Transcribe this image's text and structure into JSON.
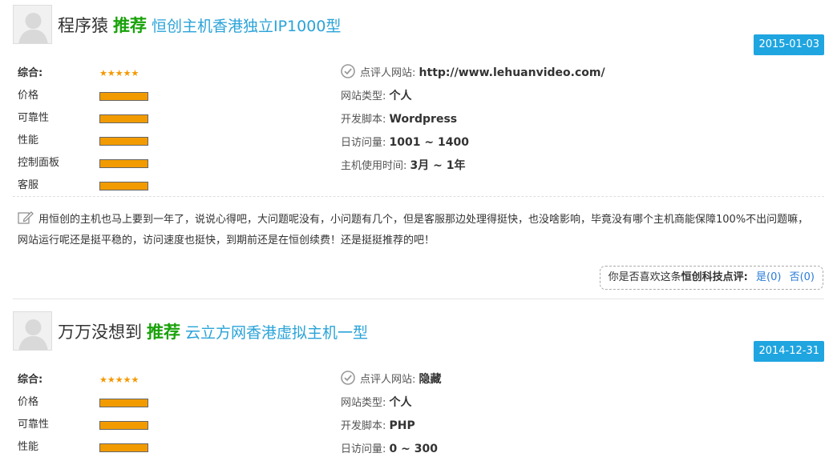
{
  "reviews": [
    {
      "username": "程序猿",
      "recommend": "推荐",
      "product": "恒创主机香港独立IP1000型",
      "date": "2015-01-03",
      "ratings": [
        {
          "label": "综合:",
          "type": "stars",
          "stars": "★★★★★",
          "value": 5
        },
        {
          "label": "价格",
          "type": "bar",
          "value": 1.0
        },
        {
          "label": "可靠性",
          "type": "bar",
          "value": 1.0
        },
        {
          "label": "性能",
          "type": "bar",
          "value": 1.0
        },
        {
          "label": "控制面板",
          "type": "bar",
          "value": 1.0
        },
        {
          "label": "客服",
          "type": "bar",
          "value": 1.0
        }
      ],
      "meta": [
        {
          "label": "点评人网站:",
          "value": "http://www.lehuanvideo.com/",
          "icon": "check-circle-icon"
        },
        {
          "label": "网站类型:",
          "value": "个人"
        },
        {
          "label": "开发脚本:",
          "value": "Wordpress"
        },
        {
          "label": "日访问量:",
          "value": "1001 ~ 1400"
        },
        {
          "label": "主机使用时间:",
          "value": "3月 ~ 1年"
        }
      ],
      "comment": "用恒创的主机也马上要到一年了，说说心得吧，大问题呢没有，小问题有几个，但是客服那边处理得挺快，也没啥影响，毕竟没有哪个主机商能保障100%不出问题嘛，网站运行呢还是挺平稳的，访问速度也挺快，到期前还是在恒创续费！还是挺挺推荐的吧！",
      "like_prompt": "你是否喜欢这条",
      "like_brand": "恒创科技点评:",
      "yes_label": "是(0)",
      "no_label": "否(0)"
    },
    {
      "username": "万万没想到",
      "recommend": "推荐",
      "product": "云立方网香港虚拟主机一型",
      "date": "2014-12-31",
      "ratings": [
        {
          "label": "综合:",
          "type": "stars",
          "stars": "★★★★★",
          "value": 5
        },
        {
          "label": "价格",
          "type": "bar",
          "value": 1.0
        },
        {
          "label": "可靠性",
          "type": "bar",
          "value": 1.0
        },
        {
          "label": "性能",
          "type": "bar",
          "value": 1.0
        }
      ],
      "meta": [
        {
          "label": "点评人网站:",
          "value": "隐藏",
          "icon": "check-circle-icon"
        },
        {
          "label": "网站类型:",
          "value": "个人"
        },
        {
          "label": "开发脚本:",
          "value": "PHP"
        },
        {
          "label": "日访问量:",
          "value": "0 ~ 300"
        }
      ]
    }
  ],
  "colors": {
    "recommend": "#19a20a",
    "product_link": "#2aa3d8",
    "date_badge": "#1fa5e0",
    "stars": "#f39800",
    "bar_fill": "#f29b00",
    "like_link": "#2a7bd8"
  }
}
